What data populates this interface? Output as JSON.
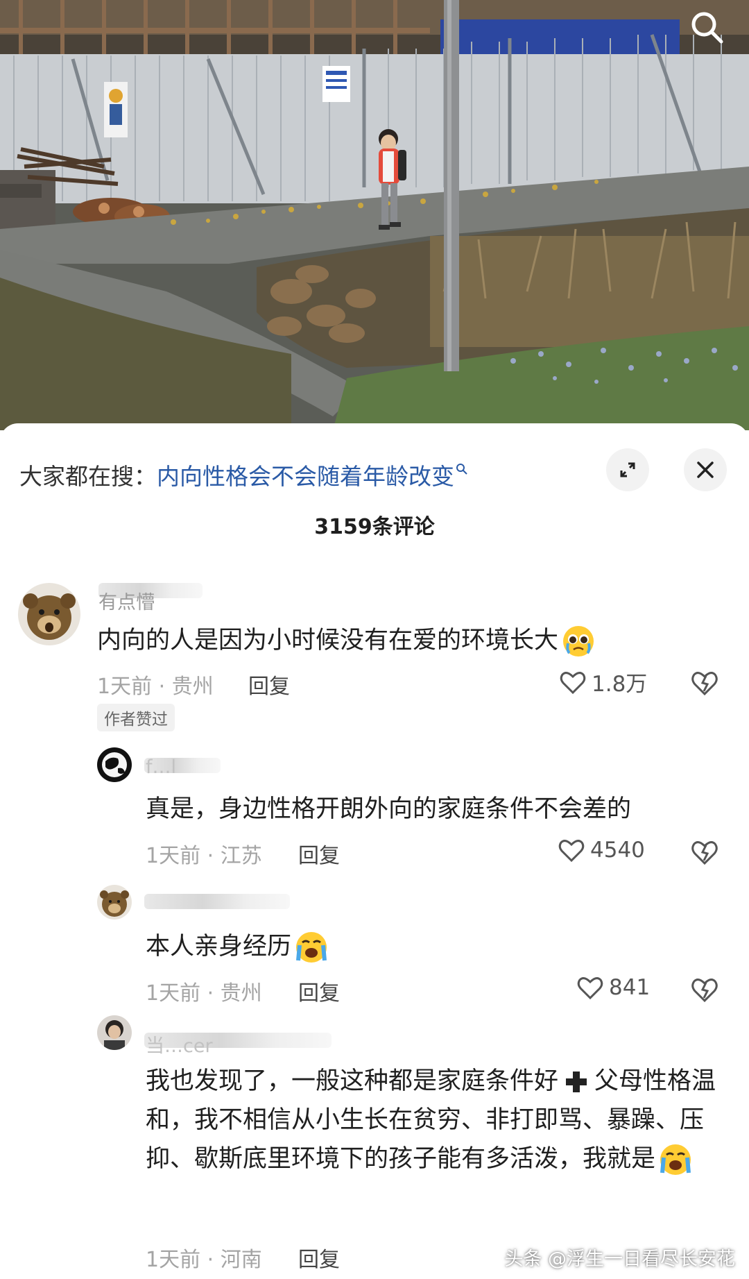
{
  "hot_search": {
    "prefix": "大家都在搜：",
    "query": "内向性格会不会随着年龄改变"
  },
  "comment_count": "3159条评论",
  "comments": [
    {
      "username": "有点懵",
      "text": "内向的人是因为小时候没有在爱的环境长大",
      "time_location": "1天前 · 贵州",
      "reply_label": "回复",
      "likes": "1.8万",
      "badge": "作者赞过",
      "emoji": "pleading-face"
    },
    {
      "username": "f…l",
      "text": "真是，身边性格开朗外向的家庭条件不会差的",
      "time_location": "1天前 · 江苏",
      "reply_label": "回复",
      "likes": "4540"
    },
    {
      "username": "",
      "text": "本人亲身经历",
      "time_location": "1天前 · 贵州",
      "reply_label": "回复",
      "likes": "841",
      "emoji": "loudly-crying-face"
    },
    {
      "username": "当…cer",
      "text_parts": [
        "我也发现了，一般这种都是家庭条件好",
        "父母性格温和，我不相信从小生长在贫穷、非打即骂、暴躁、压抑、歇斯底里环境下的孩子能有多活泼，我就是"
      ],
      "time_location": "1天前 · 河南",
      "reply_label": "回复",
      "emoji": "loudly-crying-face"
    }
  ],
  "watermark": "头条 @浮生一日看尽长安花",
  "colors": {
    "query_blue": "#2a5aa6",
    "meta_gray": "#a4a4a4",
    "sheet_bg": "#ffffff"
  },
  "icons": [
    "search-icon",
    "expand-icon",
    "close-icon",
    "heart-icon",
    "dislike-heart-icon"
  ]
}
